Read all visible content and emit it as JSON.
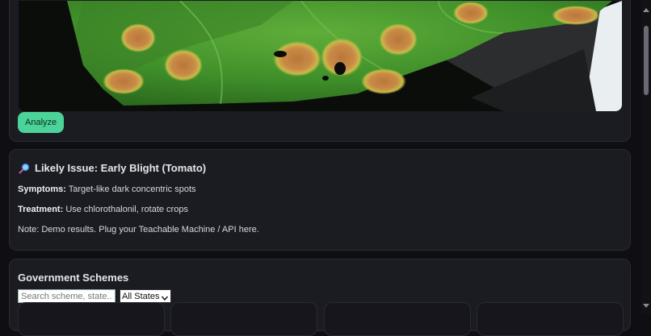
{
  "upload": {
    "analyze_label": "Analyze"
  },
  "result": {
    "title": "Likely Issue: Early Blight (Tomato)",
    "symptoms_label": "Symptoms:",
    "symptoms_value": "Target-like dark concentric spots",
    "treatment_label": "Treatment:",
    "treatment_value": "Use chlorothalonil, rotate crops",
    "note": "Note: Demo results. Plug your Teachable Machine / API here."
  },
  "schemes": {
    "title": "Government Schemes",
    "search_placeholder": "Search scheme, state...",
    "state_selected": "All States"
  },
  "colors": {
    "accent": "#4cd39a",
    "background": "#0f0f13",
    "card": "#1b1b22"
  },
  "icons": {
    "result": "magnifier-icon"
  }
}
